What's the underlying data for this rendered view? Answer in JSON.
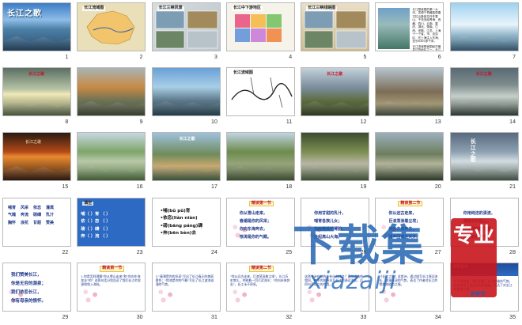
{
  "slides": [
    {
      "number": "1",
      "type": "photo",
      "bg": "linear-gradient(180deg,#3b7bc6 0%,#8dbde8 35%,#4c7fa6 55%,#2b4f6e 100%)",
      "label": "长江之歌",
      "label_style": "title-big"
    },
    {
      "number": "2",
      "type": "map",
      "bg": "#e9dfb8",
      "label": "长江流域图"
    },
    {
      "number": "3",
      "type": "collage",
      "bg": "linear-gradient(135deg,#d8dde0 0%,#bcc6cc 100%)",
      "label": "长江三峡风景"
    },
    {
      "number": "4",
      "type": "colormap",
      "bg": "#f6f4ea",
      "label": "长江中下游地区"
    },
    {
      "number": "5",
      "type": "collage",
      "bg": "linear-gradient(180deg,#e9dfc7 0%,#cdbb8f 100%)",
      "label": "长江三峡线路图"
    },
    {
      "number": "6",
      "type": "text",
      "bg": "#ffffff",
      "paragraphs": [
        "长江是我国的第一大河，发源于青藏高原唐古拉山脉各拉丹冬雪山，干流流经青海、西藏、四川、云南、重庆、湖北、湖南、江西、安徽、江苏、上海十一个省、市、自治区，在上海注入东海，全长6300多千米。",
        "长江流域是我国经济最发达的地区之一，长江干支流通航里程占全国内河通航总里程的70%。"
      ]
    },
    {
      "number": "7",
      "type": "photo",
      "bg": "linear-gradient(180deg,#9fd1f0 0%,#e8f4fb 45%,#8ab0c4 70%,#3f6a8a 100%)",
      "label": ""
    },
    {
      "number": "8",
      "type": "photo",
      "bg": "linear-gradient(180deg,#5a6e63 0%,#b7c4a6 45%,#f1e9b8 55%,#5f6f4e 100%)",
      "label": "长江之歌",
      "label_style": "red-title"
    },
    {
      "number": "9",
      "type": "photo",
      "bg": "linear-gradient(180deg,#a9b4b6 0%,#c78a44 40%,#6b7156 70%,#48523b 100%)",
      "label": ""
    },
    {
      "number": "10",
      "type": "photo",
      "bg": "linear-gradient(180deg,#6aa0d6 0%,#a8cfe7 40%,#597586 70%,#2f4d5e 100%)",
      "label": ""
    },
    {
      "number": "11",
      "type": "routemap",
      "bg": "#ffffff",
      "label": "长江流域图"
    },
    {
      "number": "12",
      "type": "photo",
      "bg": "linear-gradient(180deg,#c3d1d8 0%,#7d8fa0 40%,#5b6b3d 70%,#3d4a2c 100%)",
      "label": "长江之歌",
      "label_style": "red-title"
    },
    {
      "number": "13",
      "type": "photo",
      "bg": "linear-gradient(180deg,#b5c4cf 0%,#7c6c56 50%,#a29774 75%,#4f5c4a 100%)",
      "label": ""
    },
    {
      "number": "14",
      "type": "photo",
      "bg": "linear-gradient(180deg,#596a74 0%,#7d8b8c 35%,#c6cfca 60%,#3a4a41 100%)",
      "label": "长江之歌",
      "label_style": "red-title"
    },
    {
      "number": "15",
      "type": "photo",
      "bg": "linear-gradient(180deg,#2a1a12 0%,#b34a18 40%,#e98a30 50%,#3a1e10 100%)",
      "label": "长江之歌",
      "label_style": "sunset-title"
    },
    {
      "number": "16",
      "type": "photo",
      "bg": "linear-gradient(180deg,#c6d8e2 0%,#7ea56a 40%,#b9c8a8 60%,#567a44 100%)",
      "label": ""
    },
    {
      "number": "17",
      "type": "photo",
      "bg": "linear-gradient(180deg,#9ec2de 0%,#6f8b5c 45%,#c7a870 70%,#4d6b4c 100%)",
      "label": "长江之歌",
      "label_style": "white-title"
    },
    {
      "number": "18",
      "type": "photo",
      "bg": "linear-gradient(180deg,#c0d4e3 0%,#6d8b4d 40%,#97a47b 65%,#4d633c 100%)",
      "label": ""
    },
    {
      "number": "19",
      "type": "photo",
      "bg": "linear-gradient(180deg,#3c4c2e 0%,#7d8e52 40%,#b7b6a3 65%,#506644 100%)",
      "label": ""
    },
    {
      "number": "20",
      "type": "photo",
      "bg": "linear-gradient(180deg,#9bb0bd 0%,#6e7e5d 45%,#b1b39a 65%,#3c4b34 100%)",
      "label": ""
    },
    {
      "number": "21",
      "type": "photo",
      "bg": "linear-gradient(180deg,#586a7f 0%,#8da1b2 40%,#d2dde2 60%,#546558 100%)",
      "label": "长江之歌",
      "label_style": "vtitle"
    },
    {
      "number": "22",
      "type": "vocab",
      "bg": "#ffffff",
      "rows": [
        [
          "哺育",
          "风采",
          "依恋",
          "灌溉"
        ],
        [
          "气魄",
          "奔流",
          "磅礴",
          "乳汁"
        ],
        [
          "胸怀",
          "浪花",
          "甘甜",
          "赞美"
        ]
      ]
    },
    {
      "number": "23",
      "type": "blanks",
      "bg": "#2d6ac3",
      "label": "填空",
      "lines": [
        "哺（ ）育 （ ）",
        "依（ ）恋 （ ）",
        "磅（ ）礴 （ ）",
        "奔（ ）流 （ ）"
      ]
    },
    {
      "number": "24",
      "type": "pinyin",
      "bg": "#ffffff",
      "lines": [
        "•哺(bǔ pǔ)育",
        "•依恋(liàn niàn)",
        "•磅(bāng páng)礴",
        "•奔(bēn bèn)去"
      ]
    },
    {
      "number": "25",
      "type": "poem",
      "bg": "#ffffff",
      "badge": "精读第一节",
      "lines": [
        "你从雪山走来，",
        "春潮是你的风采；",
        "你向东海奔去，",
        "惊涛是你的气概。"
      ]
    },
    {
      "number": "26",
      "type": "poem",
      "bg": "#ffffff",
      "badge": "",
      "lines": [
        "你用甘甜的乳汁，",
        "哺育各族儿女；",
        "你用健美的臂膀，",
        "挽起高山大海。"
      ]
    },
    {
      "number": "27",
      "type": "poem",
      "bg": "#ffffff",
      "badge": "精读第二节",
      "lines": [
        "你从远古走来，",
        "巨浪荡涤着尘埃；",
        "你向未来奔去，",
        "涛声回荡在天外。"
      ]
    },
    {
      "number": "28",
      "type": "poem",
      "bg": "#ffffff",
      "badge": "",
      "lines": [
        "你用纯洁的清流，",
        "灌溉花的国土；",
        "你用磅礴的力量，",
        "推动新的时代。"
      ]
    },
    {
      "number": "29",
      "type": "poem",
      "bg": "#ffffff",
      "badge": "",
      "style": "big",
      "lines": [
        "我们赞美长江，",
        "你是无穷的源泉；",
        "我们依恋长江，",
        "你有母亲的情怀。"
      ]
    },
    {
      "number": "30",
      "type": "para",
      "bg": "#ffffff",
      "badge": "精读第一节",
      "text": "1.你是怎样理解\"你从雪山走来\"和\"你向东海奔去\"的？这两句话分别告诉了我们长江的发源地和入海处。"
    },
    {
      "number": "31",
      "type": "para",
      "bg": "#ffffff",
      "badge": "",
      "text": "2.\"春潮是你的风采\"写出了长江春天的美丽景色；\"惊涛是你的气概\"写出了长江波涛汹涌的气势。"
    },
    {
      "number": "32",
      "type": "para",
      "bg": "#ffffff",
      "badge": "精读第二节",
      "text": "\"你从远古走来，巨浪荡涤着尘埃\"，长江历史悠久，冲刷着一切污泥浊水；\"你向未来奔去\"，长江永不停息。"
    },
    {
      "number": "33",
      "type": "para",
      "bg": "#ffffff",
      "badge": "",
      "text": "这两节诗在结构上有什么特点？两节诗结构相同，每节的前四句写长江的源远流长，后四句写长江的作用。"
    },
    {
      "number": "34",
      "type": "para",
      "bg": "#ffffff",
      "badge": "",
      "text": "《长江之歌》这首诗，通过描写长江源远流长、波澜壮阔的气势，表达了作者对长江的赞美和依恋之情。"
    },
    {
      "number": "35",
      "type": "blueslide",
      "bg": "#ffffff",
      "banner": "总结全文",
      "text": "学了这首诗，我们知道了长江的雄伟气势，也体会到了长江的无私奉献，表达了对长江的赞美之情。"
    }
  ],
  "watermark": {
    "title": "下载集",
    "url": "xiazaiji",
    "seal": "专业",
    "sub": "PPT"
  }
}
